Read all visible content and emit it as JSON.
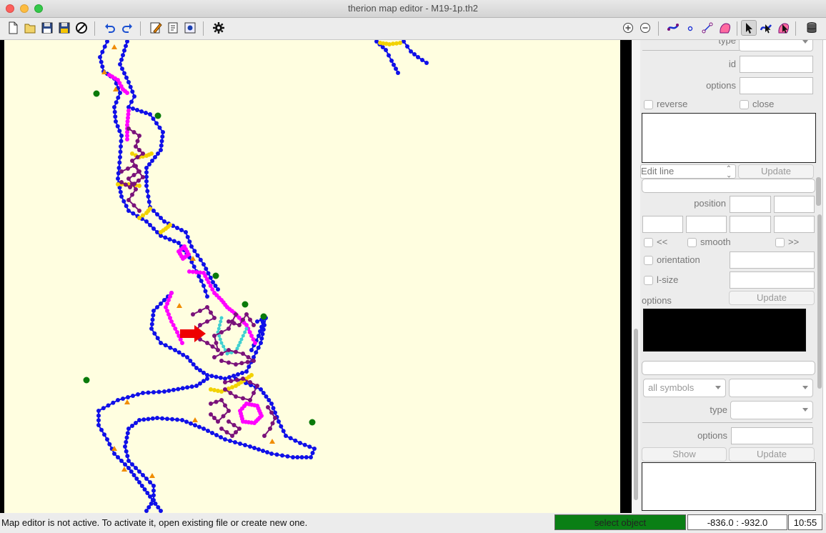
{
  "window": {
    "title": "therion map editor - M19-1p.th2"
  },
  "toolbar": {
    "left_icons": [
      "new-file-icon",
      "open-folder-icon",
      "save-icon",
      "save-as-icon",
      "close-file-icon",
      "undo-icon",
      "redo-icon",
      "edit-text-icon",
      "edit-info-icon",
      "settings-small-icon",
      "gear-icon"
    ],
    "right_icons": [
      "zoom-in-icon",
      "zoom-out-icon",
      "insert-area-icon",
      "insert-point-icon",
      "insert-line-icon",
      "insert-area-pink-icon",
      "select-arrow-icon",
      "select-area-icon",
      "select-pink-icon",
      "scrap-barrel-icon"
    ]
  },
  "panel": {
    "type_label": "type",
    "id_label": "id",
    "options_label": "options",
    "reverse_label": "reverse",
    "close_label": "close",
    "edit_line_value": "Edit line",
    "update_label": "Update",
    "position_label": "position",
    "prev_label": "<<",
    "smooth_label": "smooth",
    "next_label": ">>",
    "orientation_label": "orientation",
    "lsize_label": "l-size",
    "options2_label": "options",
    "update2_label": "Update",
    "symbols_value": "all symbols",
    "type2_label": "type",
    "options3_label": "options",
    "show_label": "Show",
    "update3_label": "Update"
  },
  "status": {
    "message": "Map editor is not active. To activate it, open existing file or create new one.",
    "mode": "select object",
    "coords": "-836.0 : -932.0",
    "zoom": "10:55",
    "mode_color": "#0a7f15"
  },
  "map_colors": {
    "wall": "#1010e8",
    "pink": "#ff00ff",
    "purple": "#7a127a",
    "yellow": "#f2d200",
    "cyan": "#40d0d0",
    "green": "#0a7a0a",
    "orange": "#f08c00",
    "red": "#ee0000",
    "paper": "#fffee0"
  }
}
